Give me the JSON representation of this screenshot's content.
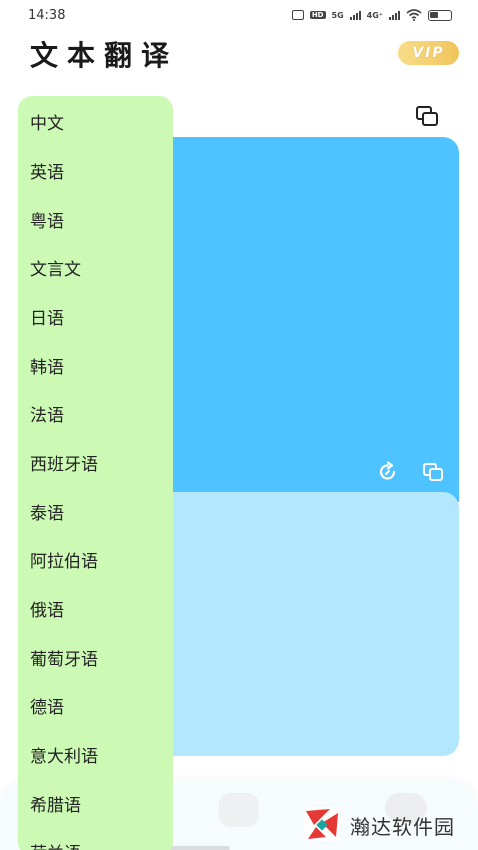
{
  "status_bar": {
    "time": "14:38",
    "hd": "HD",
    "net1": "5G",
    "net2": "4G⁺"
  },
  "header": {
    "title": "文本翻译",
    "vip": "VIP"
  },
  "language_menu": {
    "items": [
      "中文",
      "英语",
      "粤语",
      "文言文",
      "日语",
      "韩语",
      "法语",
      "西班牙语",
      "泰语",
      "阿拉伯语",
      "俄语",
      "葡萄牙语",
      "德语",
      "意大利语",
      "希腊语",
      "荷兰语"
    ]
  },
  "watermark": {
    "text": "瀚达软件园"
  },
  "colors": {
    "menu_bg": "#ccf9b4",
    "source_card": "#4fc3ff",
    "result_card": "#b2e7fd",
    "vip_gold": "#f0c45a"
  },
  "icons": {
    "top": "copy-icon",
    "source_actions": [
      "refresh-icon",
      "copy-icon"
    ]
  }
}
